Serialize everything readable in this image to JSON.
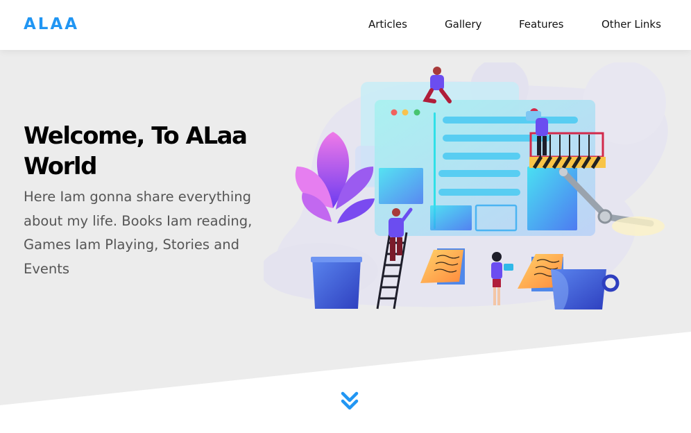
{
  "header": {
    "logo": "ALAA",
    "nav": [
      {
        "label": "Articles"
      },
      {
        "label": "Gallery"
      },
      {
        "label": "Features"
      },
      {
        "label": "Other Links"
      }
    ]
  },
  "landing": {
    "title": "Welcome, To ALaa World",
    "text": "Here Iam gonna share everything about my life. Books Iam reading, Games Iam Playing, Stories and Events"
  },
  "icons": {
    "scroll_down": "double-chevron-down-icon"
  },
  "colors": {
    "accent": "#2196f3",
    "landing_background": "#ececec",
    "header_background": "#ffffff"
  }
}
